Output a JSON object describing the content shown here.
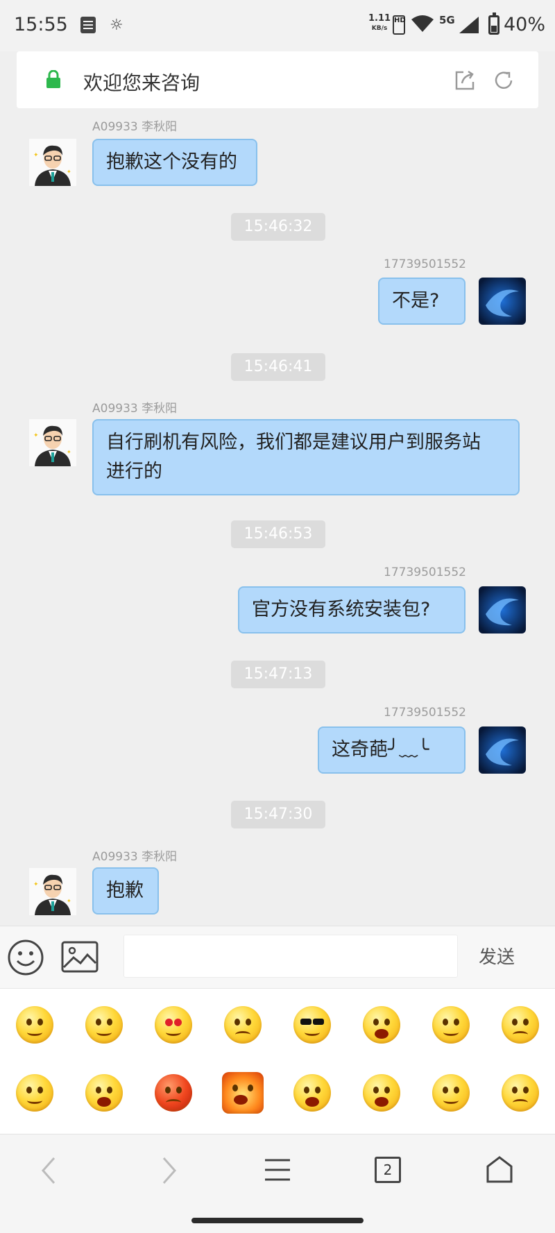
{
  "status_bar": {
    "time": "15:55",
    "net_speed": "1.11",
    "net_unit": "KB/s",
    "hd_label": "HD",
    "network": "5G",
    "battery": "40%"
  },
  "header": {
    "title": "欢迎您来咨询"
  },
  "chat": {
    "messages": [
      {
        "sender": "A09933 李秋阳",
        "text": "抱歉这个没有的"
      },
      {
        "timestamp": "15:46:32"
      },
      {
        "sender": "17739501552",
        "text": "不是?"
      },
      {
        "timestamp": "15:46:41"
      },
      {
        "sender": "A09933 李秋阳",
        "text_line1": "自行刷机有风险，我们都是建议用户到服务站",
        "text_line2": "进行的"
      },
      {
        "timestamp": "15:46:53"
      },
      {
        "sender": "17739501552",
        "text": "官方没有系统安装包?"
      },
      {
        "timestamp": "15:47:13"
      },
      {
        "sender": "17739501552",
        "text": "这奇葩╯﹏╰"
      },
      {
        "timestamp": "15:47:30"
      },
      {
        "sender": "A09933 李秋阳",
        "text": "抱歉"
      }
    ]
  },
  "input": {
    "value": "",
    "send_label": "发送"
  },
  "emoji_panel": {
    "emojis": [
      "smile",
      "shy",
      "heart-eyes",
      "dizzy",
      "cool-sunglasses",
      "laugh-tears",
      "cute",
      "cover-mouth",
      "sleepy",
      "cry",
      "angry-red",
      "furious-fire",
      "tongue",
      "grin",
      "wink-tongue",
      "sad"
    ]
  },
  "nav": {
    "tab_count": "2"
  },
  "colors": {
    "bubble": "#b3d9fb",
    "bubble_border": "#88c0ec",
    "secure_lock": "#2db84d",
    "chat_bg": "#efefef"
  }
}
